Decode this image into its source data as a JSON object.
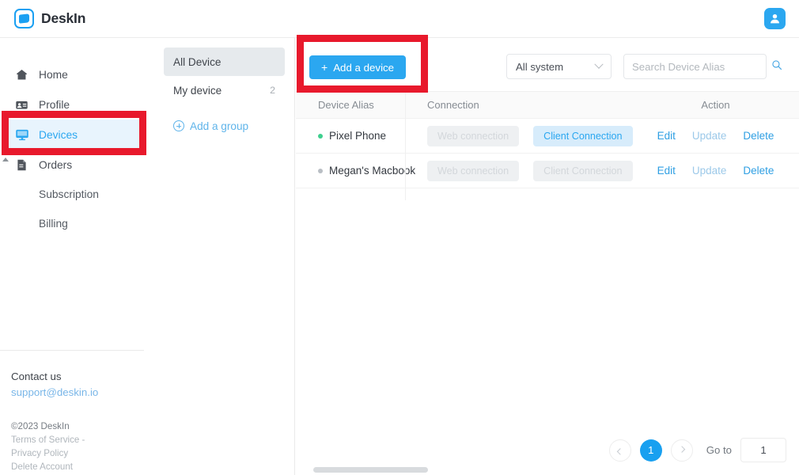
{
  "app": {
    "brand": "DeskIn",
    "logo_icon": "deskin-logo-icon",
    "avatar_icon": "user-avatar-icon",
    "accent_color": "#2BA7F0",
    "highlight_color": "#e8192c"
  },
  "sidebar": {
    "items": [
      {
        "label": "Home",
        "icon": "home-icon",
        "active": false
      },
      {
        "label": "Profile",
        "icon": "profile-icon",
        "active": false
      },
      {
        "label": "Devices",
        "icon": "monitor-icon",
        "active": true
      },
      {
        "label": "Orders",
        "icon": "document-icon",
        "active": false
      }
    ],
    "subitems": [
      {
        "label": "Subscription"
      },
      {
        "label": "Billing"
      }
    ],
    "contact": {
      "label": "Contact us",
      "email": "support@deskin.io"
    },
    "legal": {
      "copyright": "©2023 DeskIn",
      "terms": "Terms of Service -",
      "privacy": "Privacy Policy",
      "delete_account": "Delete Account"
    }
  },
  "groups": {
    "items": [
      {
        "label": "All Device",
        "count": "",
        "selected": true
      },
      {
        "label": "My device",
        "count": "2",
        "selected": false
      }
    ],
    "add_group_label": "Add a group",
    "add_group_icon": "plus-circle-icon"
  },
  "toolbar": {
    "add_device_label": "Add a device",
    "add_device_plus": "+",
    "system_filter": {
      "value": "All system",
      "options": [
        "All system"
      ],
      "icon": "chevron-down-icon"
    },
    "search": {
      "value": "",
      "placeholder": "Search Device Alias",
      "icon": "search-icon"
    }
  },
  "table": {
    "columns": [
      "Device Alias",
      "Connection",
      "Action"
    ],
    "rows": [
      {
        "alias": "Pixel Phone",
        "status": "online",
        "web_connection": "Web connection",
        "web_connection_enabled": false,
        "client_connection": "Client Connection",
        "client_connection_enabled": true,
        "actions": [
          {
            "label": "Edit",
            "muted": false
          },
          {
            "label": "Update",
            "muted": true
          },
          {
            "label": "Delete",
            "muted": false
          }
        ]
      },
      {
        "alias": "Megan's Macbook",
        "status": "offline",
        "web_connection": "Web connection",
        "web_connection_enabled": false,
        "client_connection": "Client Connection",
        "client_connection_enabled": false,
        "actions": [
          {
            "label": "Edit",
            "muted": false
          },
          {
            "label": "Update",
            "muted": true
          },
          {
            "label": "Delete",
            "muted": false
          }
        ]
      }
    ]
  },
  "pagination": {
    "prev_icon": "chevron-left-icon",
    "next_icon": "chevron-right-icon",
    "current_page": "1",
    "goto_label": "Go to",
    "goto_value": "1"
  },
  "annotations": [
    {
      "name": "devices-nav-highlight"
    },
    {
      "name": "add-device-highlight"
    }
  ]
}
